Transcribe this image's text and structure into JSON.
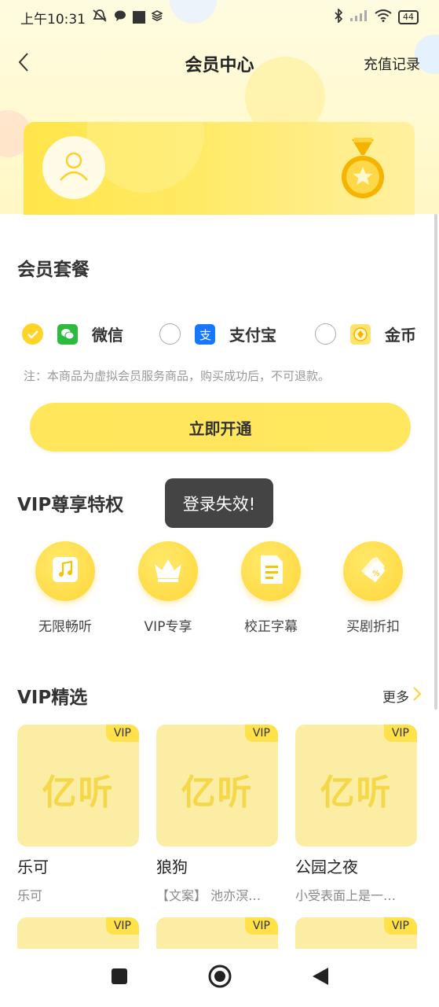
{
  "status_bar": {
    "time": "上午10:31",
    "battery": "44"
  },
  "nav": {
    "title": "会员中心",
    "right_link": "充值记录"
  },
  "plan_section": {
    "title": "会员套餐"
  },
  "payment": {
    "options": [
      {
        "label": "微信",
        "icon": "wechat-icon",
        "selected": true
      },
      {
        "label": "支付宝",
        "icon": "alipay-icon",
        "selected": false
      },
      {
        "label": "金币",
        "icon": "coin-icon",
        "selected": false
      }
    ],
    "notice": "注：本商品为虚拟会员服务商品，购买成功后，不可退款。",
    "button": "立即开通"
  },
  "toast": "登录失效!",
  "privileges": {
    "title": "VIP尊享特权",
    "items": [
      {
        "label": "无限畅听",
        "icon": "music-note-icon"
      },
      {
        "label": "VIP专享",
        "icon": "crown-icon"
      },
      {
        "label": "校正字幕",
        "icon": "document-icon"
      },
      {
        "label": "买剧折扣",
        "icon": "discount-tag-icon"
      }
    ]
  },
  "selection": {
    "title": "VIP精选",
    "more": "更多",
    "badge": "VIP",
    "logo_text": "亿听",
    "items": [
      {
        "title": "乐可",
        "subtitle": "乐可"
      },
      {
        "title": "狼狗",
        "subtitle": "【文案】 池亦溟…"
      },
      {
        "title": "公园之夜",
        "subtitle": "小受表面上是一…"
      }
    ]
  },
  "colors": {
    "accent": "#ffe14a",
    "toast_bg": "#444444",
    "text": "#333333"
  }
}
